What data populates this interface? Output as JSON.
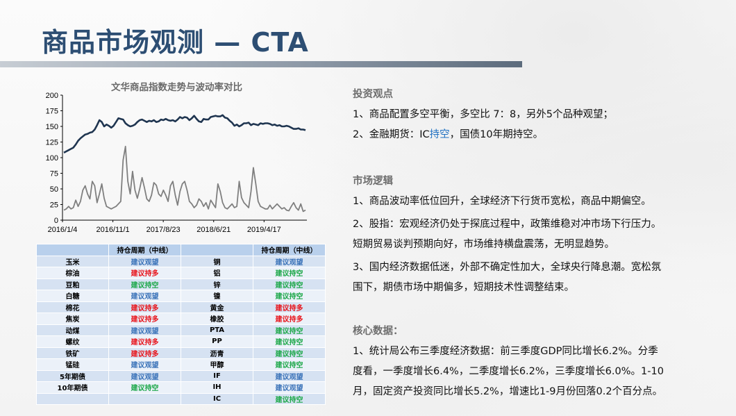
{
  "title": "商品市场观测 — CTA",
  "chart_data": {
    "type": "line",
    "title": "文华商品指数走势与波动率对比",
    "ylim": [
      0,
      200
    ],
    "yticks": [
      0,
      25,
      50,
      75,
      100,
      125,
      150,
      175,
      200
    ],
    "xticks": [
      "2016/1/4",
      "2016/11/1",
      "2017/8/23",
      "2018/6/21",
      "2019/4/17"
    ],
    "series": [
      {
        "color": "#1f3550",
        "values": [
          108,
          110,
          112,
          114,
          116,
          121,
          127,
          131,
          134,
          137,
          138,
          140,
          141,
          145,
          152,
          160,
          157,
          150,
          153,
          151,
          148,
          151,
          157,
          163,
          162,
          161,
          155,
          152,
          150,
          151,
          153,
          157,
          160,
          161,
          159,
          157,
          159,
          158,
          160,
          157,
          158,
          161,
          160,
          162,
          160,
          159,
          160,
          158,
          161,
          165,
          163,
          165,
          164,
          160,
          163,
          167,
          162,
          158,
          157,
          162,
          161,
          161,
          165,
          166,
          167,
          166,
          166,
          168,
          164,
          163,
          159,
          156,
          151,
          153,
          150,
          152,
          155,
          155,
          156,
          152,
          154,
          153,
          152,
          155,
          154,
          155,
          155,
          154,
          152,
          153,
          151,
          152,
          150,
          150,
          151,
          150,
          148,
          146,
          146,
          147,
          145,
          145,
          144
        ]
      },
      {
        "color": "#7f7f7f",
        "values": [
          16,
          18,
          22,
          18,
          20,
          32,
          22,
          30,
          48,
          55,
          42,
          34,
          62,
          55,
          28,
          42,
          58,
          35,
          22,
          20,
          18,
          20,
          22,
          26,
          30,
          96,
          118,
          62,
          42,
          78,
          48,
          35,
          50,
          68,
          52,
          34,
          30,
          40,
          60,
          56,
          42,
          38,
          48,
          40,
          30,
          55,
          62,
          40,
          24,
          46,
          58,
          62,
          48,
          30,
          26,
          20,
          24,
          34,
          30,
          22,
          28,
          18,
          32,
          26,
          20,
          58,
          46,
          28,
          20,
          18,
          22,
          26,
          20,
          22,
          62,
          36,
          28,
          24,
          20,
          46,
          84,
          58,
          30,
          22,
          20,
          18,
          18,
          24,
          18,
          22,
          26,
          22,
          18,
          20,
          16,
          15,
          22,
          28,
          20,
          16,
          26,
          14,
          16
        ]
      }
    ]
  },
  "table": {
    "header": [
      "",
      "持仓周期（中线）",
      "",
      "持仓周期（中线）"
    ],
    "rows": [
      {
        "a": "玉米",
        "as": "建议观望",
        "ac": "blue",
        "b": "铜",
        "bs": "建议观望",
        "bc": "blue"
      },
      {
        "a": "棕油",
        "as": "建议持多",
        "ac": "red",
        "b": "铝",
        "bs": "建议持空",
        "bc": "green"
      },
      {
        "a": "豆粕",
        "as": "建议持空",
        "ac": "green",
        "b": "锌",
        "bs": "建议持空",
        "bc": "green"
      },
      {
        "a": "白糖",
        "as": "建议观望",
        "ac": "blue",
        "b": "镍",
        "bs": "建议持空",
        "bc": "green"
      },
      {
        "a": "棉花",
        "as": "建议持多",
        "ac": "red",
        "b": "黄金",
        "bs": "建议持多",
        "bc": "red"
      },
      {
        "a": "焦炭",
        "as": "建议持多",
        "ac": "red",
        "b": "橡胶",
        "bs": "建议持多",
        "bc": "red"
      },
      {
        "a": "动煤",
        "as": "建议观望",
        "ac": "blue",
        "b": "PTA",
        "bs": "建议持空",
        "bc": "green"
      },
      {
        "a": "螺纹",
        "as": "建议持多",
        "ac": "red",
        "b": "PP",
        "bs": "建议持空",
        "bc": "green"
      },
      {
        "a": "铁矿",
        "as": "建议持多",
        "ac": "red",
        "b": "沥青",
        "bs": "建议持空",
        "bc": "green"
      },
      {
        "a": "锰硅",
        "as": "建议观望",
        "ac": "blue",
        "b": "甲醇",
        "bs": "建议持空",
        "bc": "green"
      },
      {
        "a": "5年期债",
        "as": "建议观望",
        "ac": "blue",
        "b": "IF",
        "bs": "建议观望",
        "bc": "blue"
      },
      {
        "a": "10年期债",
        "as": "建议持空",
        "ac": "green",
        "b": "IH",
        "bs": "建议观望",
        "bc": "blue"
      },
      {
        "a": "",
        "as": "",
        "ac": "blue",
        "b": "IC",
        "bs": "建议持空",
        "bc": "green"
      }
    ]
  },
  "sections": {
    "view": {
      "title": "投资观点",
      "p1": "1、商品配置多空平衡，多空比 7：8，另外5个品种观望；",
      "p2_pre": "2、金融期货：IC",
      "p2_hl": "持空",
      "p2_post": "，国债10年期持空。"
    },
    "logic": {
      "title": "市场逻辑",
      "p1": "1、商品波动率低位回升，全球经济下行货币宽松，商品中期偏空。",
      "p2a": "2、股指：宏观经济仍处于探底过程中，政策维稳对冲市场下行压力。",
      "p2b": "短期贸易谈判预期向好，市场维持横盘震荡，无明显趋势。",
      "p3a": "3、国内经济数据低迷，外部不确定性加大，全球央行降息潮。宽松氛",
      "p3b": "围下，期债市场中期偏多，短期技术性调整结束。"
    },
    "core": {
      "title": "核心数据：",
      "p1a": "1、统计局公布三季度经济数据：前三季度GDP同比增长6.2%。分季",
      "p1b": "度看，一季度增长6.4%，二季度增长6.2%，三季度增长6.0%。1-10",
      "p1c": "月，固定资产投资同比增长5.2%，增速比1-9月份回落0.2个百分点。"
    }
  },
  "colors": {
    "title": "#2d4e73",
    "blue": "#3b73b9",
    "red": "#e8141b",
    "green": "#1ea84a",
    "highlight": "#1e6fc1"
  }
}
